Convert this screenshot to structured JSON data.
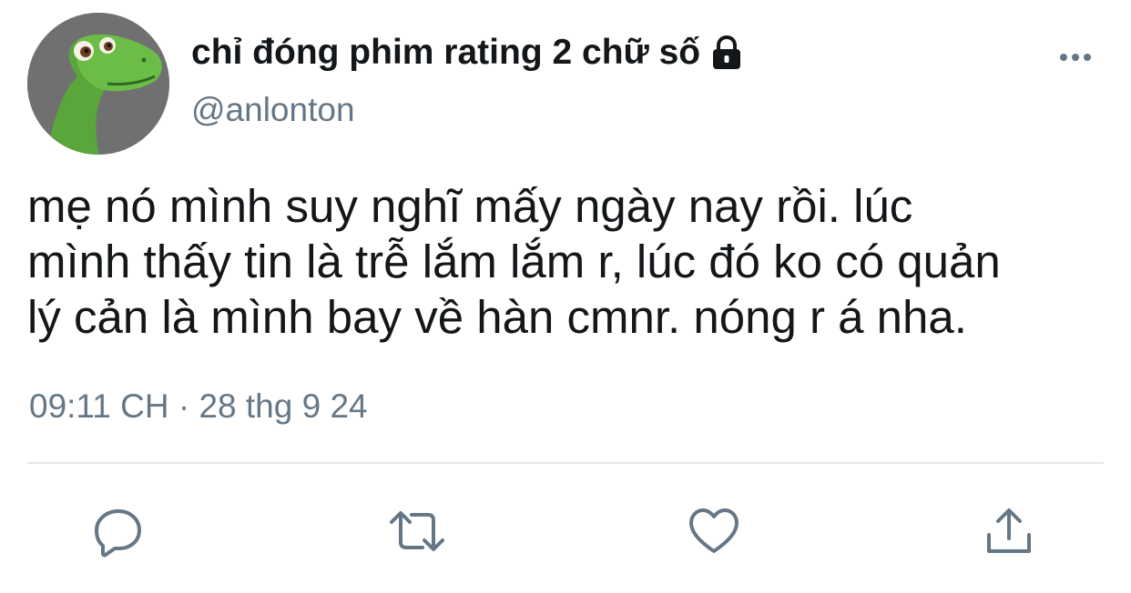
{
  "user": {
    "display_name": "chỉ đóng phim rating 2 chữ số",
    "handle": "@anlonton",
    "avatar_icon": "dinosaur-avatar",
    "protected_icon": "lock-icon"
  },
  "tweet": {
    "text": "mẹ nó mình suy nghĩ mấy ngày nay rồi. lúc\nmình thấy tin là trễ lắm lắm r, lúc đó ko có quản\nlý cản là mình bay về hàn cmnr. nóng r á nha.",
    "timestamp": "09:11 CH · 28 thg 9 24"
  },
  "actions": [
    {
      "name": "reply",
      "icon": "reply-bubble-icon"
    },
    {
      "name": "retweet",
      "icon": "retweet-icon"
    },
    {
      "name": "like",
      "icon": "heart-icon"
    },
    {
      "name": "share",
      "icon": "share-upload-icon"
    }
  ],
  "colors": {
    "text_primary": "#14171a",
    "text_secondary": "#657786",
    "icon": "#657786",
    "divider": "#e1e8ed"
  }
}
